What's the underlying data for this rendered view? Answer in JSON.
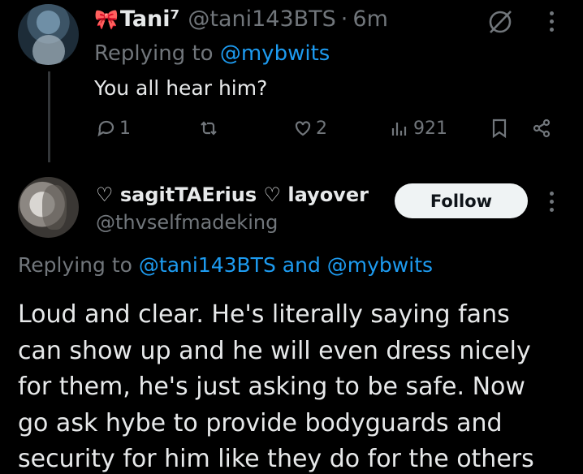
{
  "reply_tweet": {
    "display_name": "Tani⁷",
    "handle": "@tani143BTS",
    "separator": "·",
    "time": "6m",
    "replying_prefix": "Replying to",
    "replying_mention": "@mybwits",
    "text": "You all hear him?",
    "stats": {
      "replies": "1",
      "retweets": "",
      "likes": "2",
      "views": "921"
    }
  },
  "main_tweet": {
    "display_name": "♡ sagitTAErius ♡ layover",
    "handle": "@thvselfmadeking",
    "follow_label": "Follow",
    "replying_prefix": "Replying to",
    "replying_mention_1": "@tani143BTS",
    "replying_and": "and",
    "replying_mention_2": "@mybwits",
    "body_lines": [
      "Loud and clear. He's literally saying fans",
      "can show up and he will even dress nicely",
      "for them, he's just asking to be safe. Now",
      "go ask hybe to provide bodyguards and",
      "security for him like they do for the others"
    ]
  },
  "icons": {
    "bow": "ribbon-bow-icon",
    "grok": "grok-icon",
    "more": "more-vertical-icon",
    "reply": "reply-icon",
    "retweet": "retweet-icon",
    "like": "heart-icon",
    "views": "views-bar-icon",
    "bookmark": "bookmark-icon",
    "share": "share-icon"
  },
  "colors": {
    "background": "#000000",
    "text": "#e7e9ea",
    "muted": "#71767b",
    "link": "#1d9bf0",
    "follow_bg": "#eff3f4"
  }
}
